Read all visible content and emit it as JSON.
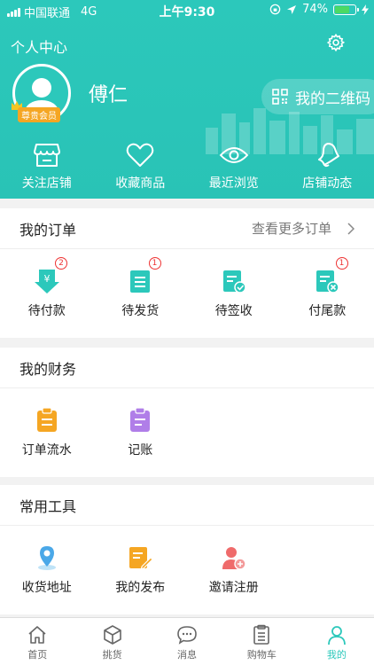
{
  "status_bar": {
    "carrier": "中国联通",
    "network": "4G",
    "time": "上午9:30",
    "battery": "74%"
  },
  "header": {
    "title": "个人中心",
    "username": "傅仁",
    "vip_label": "尊贵会员",
    "qr_label": "我的二维码",
    "quick_links": [
      {
        "label": "关注店铺",
        "icon": "store-icon"
      },
      {
        "label": "收藏商品",
        "icon": "heart-icon"
      },
      {
        "label": "最近浏览",
        "icon": "eye-icon"
      },
      {
        "label": "店铺动态",
        "icon": "bell-icon"
      }
    ]
  },
  "orders": {
    "title": "我的订单",
    "more": "查看更多订单",
    "items": [
      {
        "label": "待付款",
        "badge": "2"
      },
      {
        "label": "待发货",
        "badge": "1"
      },
      {
        "label": "待签收",
        "badge": ""
      },
      {
        "label": "付尾款",
        "badge": "1"
      }
    ]
  },
  "finance": {
    "title": "我的财务",
    "items": [
      {
        "label": "订单流水"
      },
      {
        "label": "记账"
      }
    ]
  },
  "tools": {
    "title": "常用工具",
    "items": [
      {
        "label": "收货地址"
      },
      {
        "label": "我的发布"
      },
      {
        "label": "邀请注册"
      }
    ]
  },
  "tabbar": {
    "items": [
      {
        "label": "首页",
        "active": false
      },
      {
        "label": "挑货",
        "active": false
      },
      {
        "label": "消息",
        "active": false
      },
      {
        "label": "购物车",
        "active": false
      },
      {
        "label": "我的",
        "active": true
      }
    ]
  },
  "colors": {
    "brand": "#2cc8bb",
    "badge": "#e33333",
    "vip": "#f5a623"
  }
}
